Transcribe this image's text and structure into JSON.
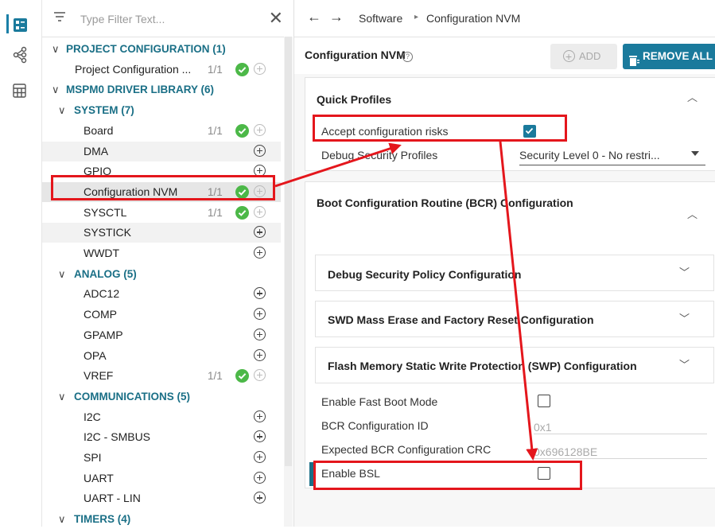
{
  "rail": {
    "icons": [
      "layout-icon",
      "hierarchy-icon",
      "calculator-icon"
    ]
  },
  "tree": {
    "filter_placeholder": "Type Filter Text...",
    "rows": [
      {
        "kind": "cat",
        "label": "PROJECT CONFIGURATION (1)"
      },
      {
        "kind": "item",
        "label": "Project Configuration ...",
        "count": "1/1",
        "ok": true,
        "plus": "dim"
      },
      {
        "kind": "cat",
        "label": "MSPM0 DRIVER LIBRARY (6)"
      },
      {
        "kind": "subcat",
        "label": "SYSTEM (7)"
      },
      {
        "kind": "item",
        "label": "Board",
        "count": "1/1",
        "ok": true,
        "plus": "dim"
      },
      {
        "kind": "item",
        "label": "DMA",
        "count": "",
        "ok": false,
        "plus": "on"
      },
      {
        "kind": "item",
        "label": "GPIO",
        "count": "",
        "ok": false,
        "plus": "on"
      },
      {
        "kind": "item",
        "label": "Configuration NVM",
        "count": "1/1",
        "ok": true,
        "plus": "dim",
        "selected": true
      },
      {
        "kind": "item",
        "label": "SYSCTL",
        "count": "1/1",
        "ok": true,
        "plus": "dim"
      },
      {
        "kind": "item",
        "label": "SYSTICK",
        "count": "",
        "ok": false,
        "plus": "on"
      },
      {
        "kind": "item",
        "label": "WWDT",
        "count": "",
        "ok": false,
        "plus": "on"
      },
      {
        "kind": "subcat",
        "label": "ANALOG (5)"
      },
      {
        "kind": "item",
        "label": "ADC12",
        "count": "",
        "ok": false,
        "plus": "on"
      },
      {
        "kind": "item",
        "label": "COMP",
        "count": "",
        "ok": false,
        "plus": "on"
      },
      {
        "kind": "item",
        "label": "GPAMP",
        "count": "",
        "ok": false,
        "plus": "on"
      },
      {
        "kind": "item",
        "label": "OPA",
        "count": "",
        "ok": false,
        "plus": "on"
      },
      {
        "kind": "item",
        "label": "VREF",
        "count": "1/1",
        "ok": true,
        "plus": "dim"
      },
      {
        "kind": "subcat",
        "label": "COMMUNICATIONS (5)"
      },
      {
        "kind": "item",
        "label": "I2C",
        "count": "",
        "ok": false,
        "plus": "on"
      },
      {
        "kind": "item",
        "label": "I2C - SMBUS",
        "count": "",
        "ok": false,
        "plus": "on"
      },
      {
        "kind": "item",
        "label": "SPI",
        "count": "",
        "ok": false,
        "plus": "on"
      },
      {
        "kind": "item",
        "label": "UART",
        "count": "",
        "ok": false,
        "plus": "on"
      },
      {
        "kind": "item",
        "label": "UART - LIN",
        "count": "",
        "ok": false,
        "plus": "on"
      },
      {
        "kind": "subcat",
        "label": "TIMERS (4)"
      }
    ]
  },
  "breadcrumb": {
    "items": [
      "Software",
      "Configuration NVM"
    ]
  },
  "page": {
    "title": "Configuration NVM",
    "help_glyph": "?",
    "add_label": "ADD",
    "remove_all_label": "REMOVE ALL"
  },
  "quick_profiles": {
    "title": "Quick Profiles",
    "accept_risks_label": "Accept configuration risks",
    "accept_risks_checked": true,
    "debug_profiles_label": "Debug Security Profiles",
    "debug_profiles_value": "Security Level 0 - No restri..."
  },
  "bcr": {
    "title": "Boot Configuration Routine (BCR) Configuration",
    "subsections": [
      "Debug Security Policy Configuration",
      "SWD Mass Erase and Factory Reset Configuration",
      "Flash Memory Static Write Protection (SWP) Configuration"
    ],
    "fast_boot_label": "Enable Fast Boot Mode",
    "fast_boot_checked": false,
    "config_id_label": "BCR Configuration ID",
    "config_id_value": "0x1",
    "crc_label": "Expected BCR Configuration CRC",
    "crc_value": "0x696128BE",
    "bsl_label": "Enable BSL",
    "bsl_checked": false
  },
  "colors": {
    "accent": "#1a7a9c",
    "category_text": "#1a6f86",
    "ok_green": "#4cb848",
    "highlight_red": "#e4161c"
  }
}
